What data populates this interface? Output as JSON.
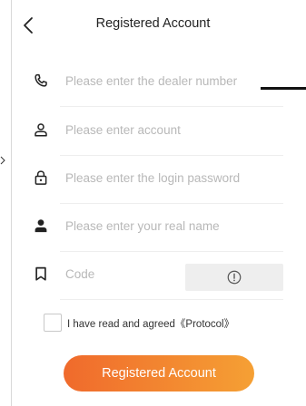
{
  "header": {
    "title": "Registered Account",
    "back_icon": "chevron-left-icon"
  },
  "form": {
    "dealer_number": {
      "placeholder": "Please enter the dealer number",
      "value": "",
      "icon": "phone-icon"
    },
    "account": {
      "placeholder": "Please enter account",
      "value": "",
      "icon": "user-outline-icon"
    },
    "password": {
      "placeholder": "Please enter the login password",
      "value": "",
      "icon": "lock-icon"
    },
    "real_name": {
      "placeholder": "Please enter your real name",
      "value": "",
      "icon": "user-filled-icon"
    },
    "code": {
      "placeholder": "Code",
      "value": "",
      "icon": "bookmark-icon",
      "captcha_icon": "alert-circle-icon"
    }
  },
  "agreement": {
    "text": "I have read and agreed《Protocol》",
    "checked": false
  },
  "submit": {
    "label": "Registered Account"
  },
  "colors": {
    "accent_start": "#f06a2c",
    "accent_end": "#f5a034",
    "placeholder": "#b8b8b8",
    "divider": "#eeeeee"
  }
}
